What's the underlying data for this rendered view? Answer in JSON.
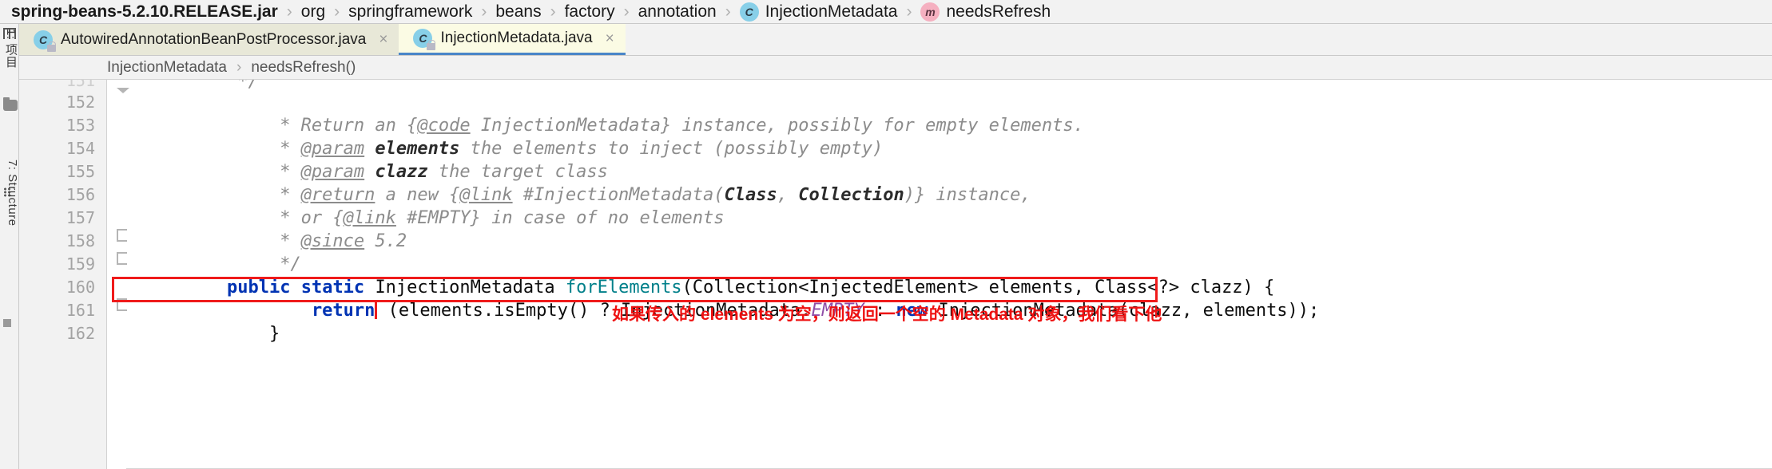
{
  "breadcrumb": {
    "items": [
      {
        "label": "spring-beans-5.2.10.RELEASE.jar",
        "icon": "",
        "bold": true
      },
      {
        "label": "org",
        "icon": ""
      },
      {
        "label": "springframework",
        "icon": ""
      },
      {
        "label": "beans",
        "icon": ""
      },
      {
        "label": "factory",
        "icon": ""
      },
      {
        "label": "annotation",
        "icon": ""
      },
      {
        "label": "InjectionMetadata",
        "icon": "class-icon",
        "badge": "C"
      },
      {
        "label": "needsRefresh",
        "icon": "method-icon",
        "badge": "m"
      }
    ],
    "separator": "›"
  },
  "toolstrip": {
    "project_label": "1: 项目",
    "structure_label": "7: Structure",
    "icons": [
      "grid-icon",
      "folder-icon",
      "dots-icon",
      "square-icon"
    ]
  },
  "tabs": [
    {
      "label": "AutowiredAnnotationBeanPostProcessor.java",
      "badge": "C",
      "active": false,
      "close": "×",
      "readonly": true
    },
    {
      "label": "InjectionMetadata.java",
      "badge": "C",
      "active": true,
      "close": "×",
      "readonly": true
    }
  ],
  "subcrumb": {
    "class": "InjectionMetadata",
    "separator": "›",
    "member": "needsRefresh()"
  },
  "gutter": {
    "lines": [
      "151",
      "152",
      "153",
      "154",
      "155",
      "156",
      "157",
      "158",
      "159",
      "160",
      "161",
      "162"
    ],
    "annotation_mark": "@"
  },
  "code": {
    "line151": " */",
    "line152": {
      "a": "     * Return an {",
      "tag": "@code",
      "b": " InjectionMetadata} instance, possibly for empty elements."
    },
    "line153": {
      "a": "     * ",
      "tag": "@param",
      "b": " ",
      "bold": "elements",
      "c": " the elements to inject (possibly empty)"
    },
    "line154": {
      "a": "     * ",
      "tag": "@param",
      "b": " ",
      "bold": "clazz",
      "c": " the target class"
    },
    "line155": {
      "a": "     * ",
      "tag": "@return",
      "b": " a new {",
      "tag2": "@link",
      "c": " #InjectionMetadata(",
      "bold": "Class",
      "d": ", ",
      "bold2": "Collection",
      "e": ")} instance,"
    },
    "line156": {
      "a": "     * or {",
      "tag": "@link",
      "b": " #EMPTY} in case of no elements"
    },
    "line157": {
      "a": "     * ",
      "tag": "@since",
      "b": " 5.2"
    },
    "line158": "     */",
    "line159": {
      "kw1": "public",
      "sp1": " ",
      "kw2": "static",
      "sp2": " ",
      "type": "InjectionMetadata",
      "sp3": " ",
      "method": "forElements",
      "rest": "(Collection<InjectedElement> elements, Class<?> clazz) {"
    },
    "line160": {
      "indent": "        ",
      "kw": "return",
      "a": " (elements.isEmpty() ? InjectionMetadata.",
      "field": "EMPTY",
      "b": " : ",
      "kw2": "new",
      "c": " InjectionMetadata(clazz, elements));"
    },
    "line161": "    }",
    "line162": ""
  },
  "annotation": {
    "note_text": "如果传入的 elements 为空，则返回一个空的 Metadata 对象，我们看下他",
    "color": "#ee1111"
  },
  "colors": {
    "keyword": "#0033b3",
    "method": "#00808a",
    "static_field": "#8f4ea8",
    "javadoc": "#8c8c8c",
    "tab_active_bg": "#fbfbe4",
    "tab_inactive_bg": "#e8e8d8",
    "tab_underline": "#4a86c8",
    "highlight_border": "#ef1b1b",
    "class_badge": "#87cfe8",
    "method_badge": "#f5b0c0"
  }
}
